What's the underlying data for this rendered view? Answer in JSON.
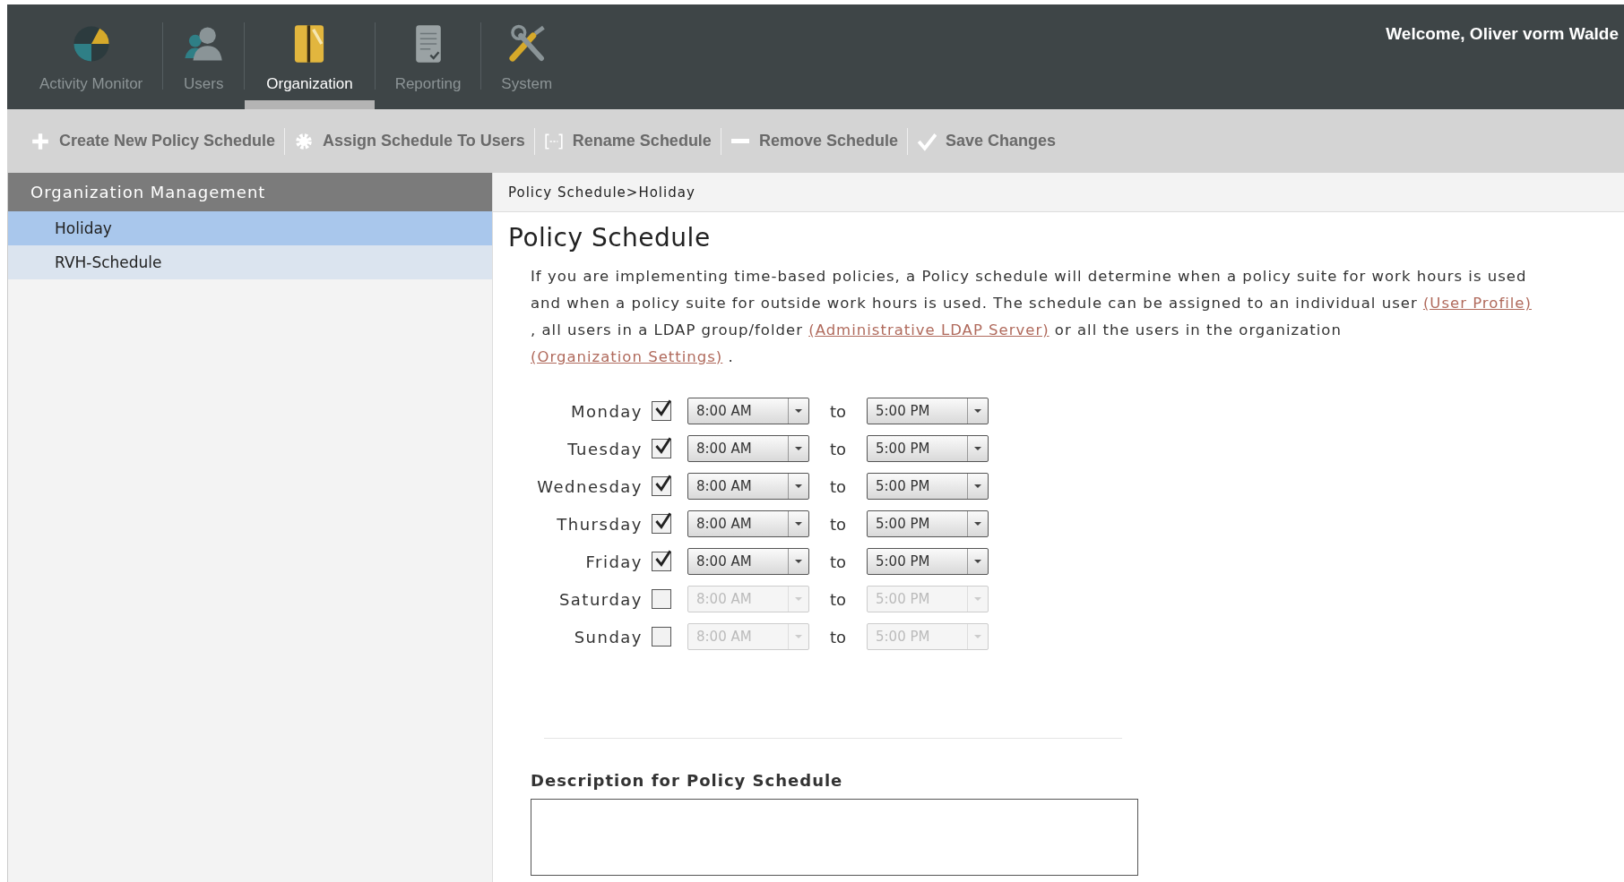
{
  "nav": {
    "tabs": [
      {
        "label": "Activity Monitor",
        "kind": "monitor",
        "selected": false
      },
      {
        "label": "Users",
        "kind": "users",
        "selected": false
      },
      {
        "label": "Organization",
        "kind": "organization",
        "selected": true
      },
      {
        "label": "Reporting",
        "kind": "reporting",
        "selected": false
      },
      {
        "label": "System",
        "kind": "system",
        "selected": false
      }
    ],
    "welcome": "Welcome,  Oliver vorm Walde"
  },
  "toolbar": [
    {
      "label": "Create New Policy Schedule",
      "kind": "plus"
    },
    {
      "label": "Assign Schedule To Users",
      "kind": "gear"
    },
    {
      "label": "Rename Schedule",
      "kind": "rename"
    },
    {
      "label": "Remove Schedule",
      "kind": "minus"
    },
    {
      "label": "Save Changes",
      "kind": "check"
    }
  ],
  "sidebar": {
    "title": "Organization Management",
    "items": [
      {
        "label": "Holiday",
        "selected": true
      },
      {
        "label": "RVH-Schedule",
        "selected": false
      }
    ]
  },
  "breadcrumb": "Policy Schedule>Holiday",
  "heading": "Policy Schedule",
  "intro": [
    {
      "kind": "text",
      "text": "If you are implementing time-based policies, a Policy schedule will determine when a policy suite for work hours is used and when a policy suite for outside work hours is used. The schedule  can be assigned to an individual user "
    },
    {
      "kind": "link",
      "text": "(User Profile)"
    },
    {
      "kind": "text",
      "text": " , all users in a LDAP group/folder "
    },
    {
      "kind": "link",
      "text": "(Administrative LDAP Server)"
    },
    {
      "kind": "text",
      "text": " or all the users in the organization "
    },
    {
      "kind": "link",
      "text": "(Organization Settings)"
    },
    {
      "kind": "text",
      "text": " ."
    }
  ],
  "days": [
    {
      "day": "Monday",
      "checked": true,
      "from": "8:00 AM",
      "to_label": "to",
      "to": "5:00 PM"
    },
    {
      "day": "Tuesday",
      "checked": true,
      "from": "8:00 AM",
      "to_label": "to",
      "to": "5:00 PM"
    },
    {
      "day": "Wednesday",
      "checked": true,
      "from": "8:00 AM",
      "to_label": "to",
      "to": "5:00 PM"
    },
    {
      "day": "Thursday",
      "checked": true,
      "from": "8:00 AM",
      "to_label": "to",
      "to": "5:00 PM"
    },
    {
      "day": "Friday",
      "checked": true,
      "from": "8:00 AM",
      "to_label": "to",
      "to": "5:00 PM"
    },
    {
      "day": "Saturday",
      "checked": false,
      "from": "8:00 AM",
      "to_label": "to",
      "to": "5:00 PM"
    },
    {
      "day": "Sunday",
      "checked": false,
      "from": "8:00 AM",
      "to_label": "to",
      "to": "5:00 PM"
    }
  ],
  "description": {
    "label": "Description for Policy Schedule"
  }
}
